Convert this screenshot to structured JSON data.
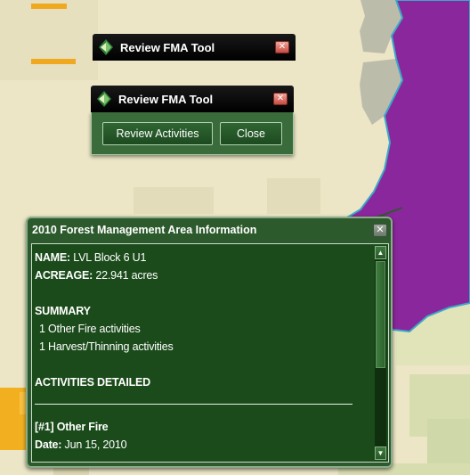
{
  "tool_window_back": {
    "title": "Review FMA Tool",
    "close_symbol": "✕"
  },
  "tool_window_front": {
    "title": "Review FMA Tool",
    "close_symbol": "✕",
    "review_activities_label": "Review Activities",
    "close_label": "Close"
  },
  "info_popup": {
    "title": "2010 Forest Management Area Information",
    "close_symbol": "✕",
    "name_label": "NAME:",
    "name_value": "LVL Block 6 U1",
    "acreage_label": "ACREAGE:",
    "acreage_value": "22.941 acres",
    "summary_heading": "SUMMARY",
    "summary_items": [
      "1 Other Fire activities",
      "1 Harvest/Thinning activities"
    ],
    "activities_heading": "ACTIVITIES DETAILED",
    "activity_title": "[#1] Other Fire",
    "date_label": "Date:",
    "date_value": "Jun 15, 2010",
    "scroll_up_symbol": "▲",
    "scroll_down_symbol": "▼"
  },
  "colors": {
    "map_background": "#ece6c6",
    "fma_polygon": "#8b279c",
    "fma_outline": "#3aa8c8",
    "gray_parcel": "#bcbcab",
    "orange_parcel": "#f0a81f",
    "panel_green": "#2c5a2c"
  }
}
